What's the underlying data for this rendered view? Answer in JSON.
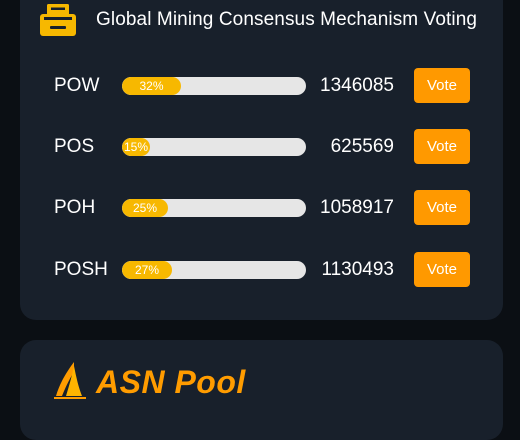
{
  "header": {
    "title": "Global Mining Consensus Mechanism Voting",
    "icon": "ballot-box-icon"
  },
  "colors": {
    "background": "#0b0f14",
    "card": "#18202b",
    "bar_fill": "#f7b800",
    "bar_track": "#e6e6e6",
    "vote_button": "#ff9900",
    "brand": "#ff9c00"
  },
  "mechanisms": [
    {
      "label": "POW",
      "percent": 32,
      "percent_label": "32%",
      "votes": "1346085",
      "button": "Vote"
    },
    {
      "label": "POS",
      "percent": 15,
      "percent_label": "15%",
      "votes": "625569",
      "button": "Vote"
    },
    {
      "label": "POH",
      "percent": 25,
      "percent_label": "25%",
      "votes": "1058917",
      "button": "Vote"
    },
    {
      "label": "POSH",
      "percent": 27,
      "percent_label": "27%",
      "votes": "1130493",
      "button": "Vote"
    }
  ],
  "pool": {
    "name": "ASN Pool",
    "logo_icon": "asn-sail-logo-icon"
  }
}
